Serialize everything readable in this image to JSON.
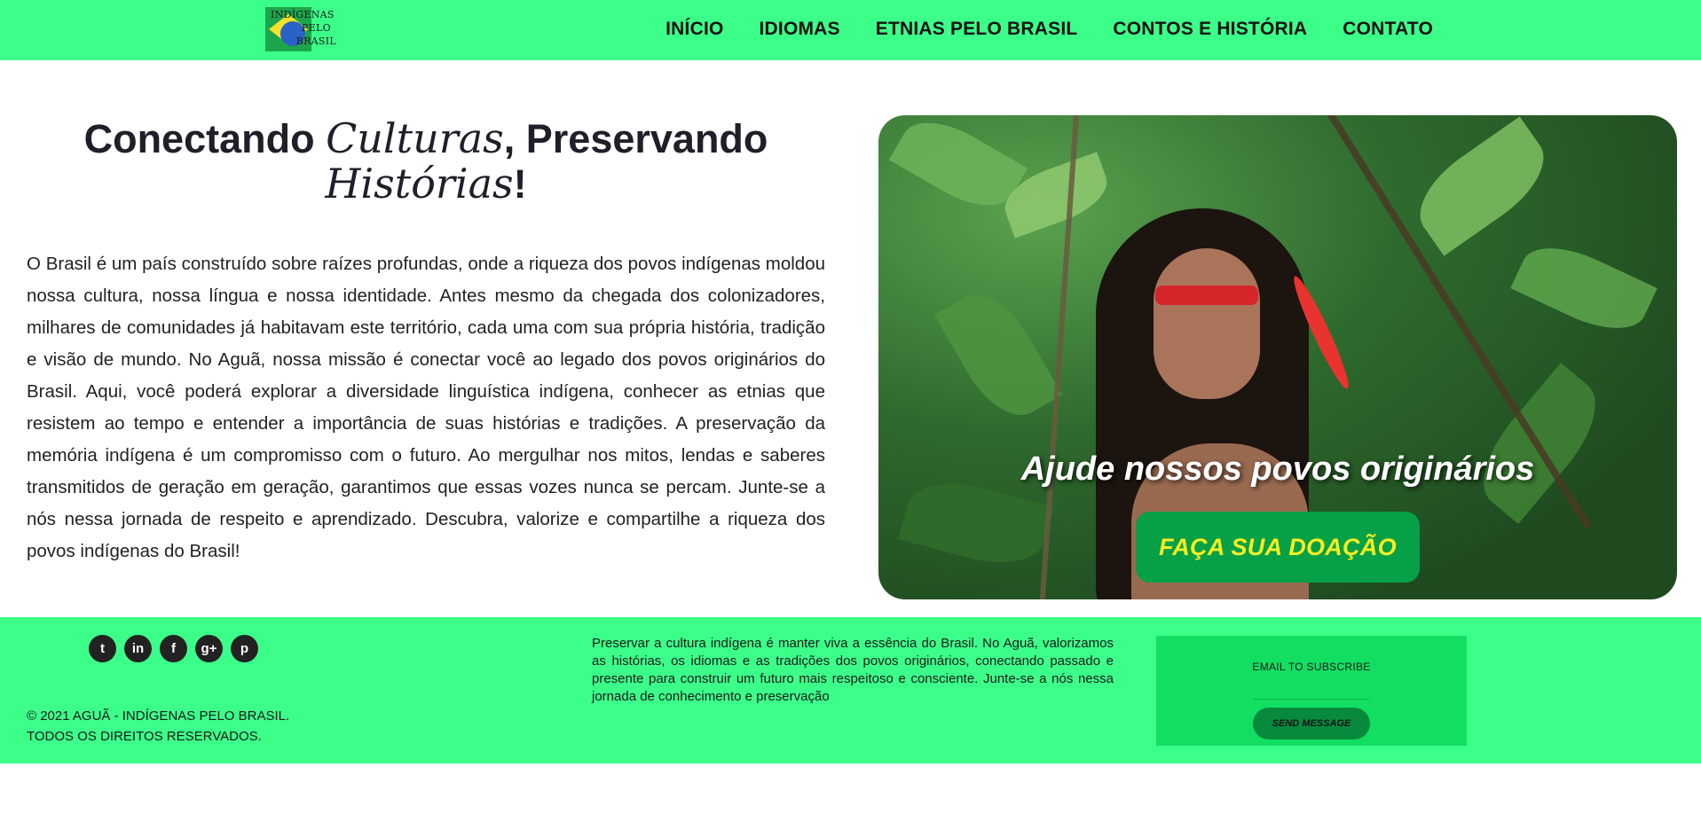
{
  "header": {
    "logo": {
      "lines": [
        "INDÍGENAS",
        "PELO",
        "BRASIL"
      ],
      "icon": "brazil-flag-icon"
    },
    "nav": [
      "INÍCIO",
      "IDIOMAS",
      "ETNIAS PELO BRASIL",
      "CONTOS E HISTÓRIA",
      "CONTATO"
    ]
  },
  "hero": {
    "title_part1": "Conectando ",
    "title_script1": "Culturas",
    "title_part2": ", Preservando ",
    "title_script2": "Histórias",
    "title_part3": "!",
    "body": "O Brasil é um país construído sobre raízes profundas, onde a riqueza dos povos indígenas moldou nossa cultura, nossa língua e nossa identidade. Antes mesmo da chegada dos colonizadores, milhares de comunidades já habitavam este território, cada uma com sua própria história, tradição e visão de mundo. No Aguã, nossa missão é conectar você ao legado dos povos originários do Brasil. Aqui, você poderá explorar a diversidade linguística indígena, conhecer as etnias que resistem ao tempo e entender a importância de suas histórias e tradições. A preservação da memória indígena é um compromisso com o futuro. Ao mergulhar nos mitos, lendas e saberes transmitidos de geração em geração, garantimos que essas vozes nunca se percam. Junte-se a nós nessa jornada de respeito e aprendizado. Descubra, valorize e compartilhe a riqueza dos povos indígenas do Brasil!",
    "donate_heading": "Ajude nossos povos originários",
    "donate_button": "FAÇA SUA DOAÇÃO"
  },
  "footer": {
    "socials": [
      {
        "icon": "twitter-icon",
        "glyph": "t"
      },
      {
        "icon": "linkedin-icon",
        "glyph": "in"
      },
      {
        "icon": "facebook-icon",
        "glyph": "f"
      },
      {
        "icon": "google-plus-icon",
        "glyph": "g+"
      },
      {
        "icon": "pinterest-icon",
        "glyph": "p"
      }
    ],
    "copyright_line1": "© 2021 AGUÃ - INDÍGENAS PELO BRASIL.",
    "copyright_line2": "TODOS OS DIREITOS RESERVADOS.",
    "text": "Preservar a cultura indígena é manter viva a essência do Brasil. No Aguã, valorizamos as histórias, os idiomas e as tradições dos povos originários, conectando passado e presente para construir um futuro mais respeitoso e consciente. Junte-se a nós nessa jornada de conhecimento e preservação",
    "subscribe_label": "EMAIL TO SUBSCRIBE",
    "send_button": "SEND MESSAGE"
  },
  "colors": {
    "brand_green": "#3cff8a",
    "subscribe_panel": "#12df61",
    "donate_button": "#06a146",
    "donate_text": "#f6ee22",
    "send_button": "#088a3e"
  }
}
